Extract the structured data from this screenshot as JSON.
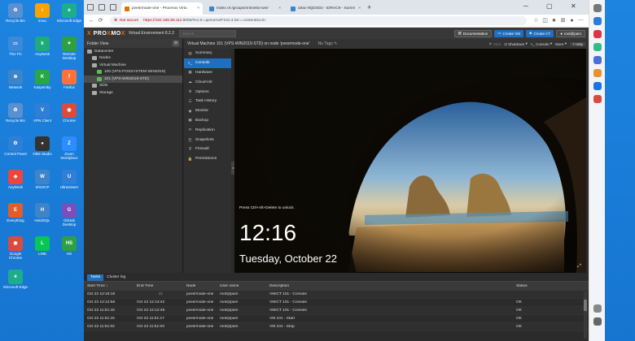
{
  "desktop": {
    "icons": [
      {
        "label": "Recycle Bin",
        "color": "#5a8fd0",
        "glyph": "♻"
      },
      {
        "label": "imou",
        "color": "#f6a400",
        "glyph": "i"
      },
      {
        "label": "Microsoft Edge",
        "color": "#1cae8a",
        "glyph": "e"
      },
      {
        "label": "This PC",
        "color": "#3d89d9",
        "glyph": "▭"
      },
      {
        "label": "AnyDesk",
        "color": "#1faa7b",
        "glyph": "k"
      },
      {
        "label": "Remote Desktop",
        "color": "#2ea043",
        "glyph": "✦"
      },
      {
        "label": "Network",
        "color": "#3e84c9",
        "glyph": "⊕"
      },
      {
        "label": "Kaspersky",
        "color": "#28a745",
        "glyph": "K"
      },
      {
        "label": "Firefox",
        "color": "#ff7139",
        "glyph": "f"
      },
      {
        "label": "Recycle Bin",
        "color": "#5a8fd0",
        "glyph": "♻"
      },
      {
        "label": "VPN Client",
        "color": "#2f7fd6",
        "glyph": "V"
      },
      {
        "label": "Chrome",
        "color": "#d94c3d",
        "glyph": "◉"
      },
      {
        "label": "Control Panel",
        "color": "#2f7fd6",
        "glyph": "⚙"
      },
      {
        "label": "OBS Studio",
        "color": "#333",
        "glyph": "●"
      },
      {
        "label": "Zoom Workplace",
        "color": "#2d8cff",
        "glyph": "Z"
      },
      {
        "label": "AnyDesk",
        "color": "#ef443b",
        "glyph": "◆"
      },
      {
        "label": "WinSCP",
        "color": "#3e84c9",
        "glyph": "W"
      },
      {
        "label": "Ultraviewer",
        "color": "#2f7fd6",
        "glyph": "U"
      },
      {
        "label": "Everything",
        "color": "#e55c2b",
        "glyph": "E"
      },
      {
        "label": "HeidiSQL",
        "color": "#3e84c9",
        "glyph": "H"
      },
      {
        "label": "GitHub Desktop",
        "color": "#7c4dbd",
        "glyph": "G"
      },
      {
        "label": "Google Chrome",
        "color": "#d94c3d",
        "glyph": "◉"
      },
      {
        "label": "LINE",
        "color": "#06c755",
        "glyph": "L"
      },
      {
        "label": "HS",
        "color": "#2ea043",
        "glyph": "HS"
      },
      {
        "label": "Microsoft Edge",
        "color": "#1cae8a",
        "glyph": "e"
      }
    ]
  },
  "browser": {
    "tabs": [
      {
        "title": "pvesrmode-one - Proxmox Virtu",
        "active": true,
        "color": "#e57000"
      },
      {
        "title": "Index of /groups/vnt/virtio-win/",
        "active": false,
        "color": "#3e84c9"
      },
      {
        "title": "idrac-9QD4D2 - iDRAC9 - Summ",
        "active": false,
        "color": "#3e84c9"
      }
    ],
    "new_tab": "+",
    "not_secure": "Not secure",
    "url_host": "https://192.168.98.111",
    "url_rest": ":8006/#v1:0:=qemu%2F101:4:25:=:contentIso:8::"
  },
  "pve": {
    "logo_a": "PRO",
    "logo_x": "X",
    "logo_b": "MO",
    "logo_x2": "X",
    "version": "Virtual Environment 8.2.2",
    "search_placeholder": "Search",
    "documentation": "Documentation",
    "create_vm": "Create VM",
    "create_ct": "Create CT",
    "user": "root@pam",
    "folder_view": "Folder View",
    "tree": [
      {
        "label": "Datacenter",
        "indent": 0,
        "color": "#9aa"
      },
      {
        "label": "Nodes",
        "indent": 1,
        "color": "#aaa"
      },
      {
        "label": "Virtual Machine",
        "indent": 1,
        "color": "#aaa"
      },
      {
        "label": "100 (VPS-POSSYSTEM-WIN2019)",
        "indent": 2,
        "color": "#5cb85c"
      },
      {
        "label": "101 (VPS-WIN2019-STD)",
        "indent": 2,
        "color": "#5cb85c",
        "selected": true
      },
      {
        "label": "SDN",
        "indent": 1,
        "color": "#aaa"
      },
      {
        "label": "Storage",
        "indent": 1,
        "color": "#aaa"
      }
    ],
    "vm_title": "Virtual Machine 101 (VPS-WIN2019-STD) on node 'pvesrmode-one'",
    "no_tags": "No Tags",
    "actions": {
      "start": "Start",
      "shutdown": "Shutdown",
      "console": "Console",
      "more": "More",
      "help": "Help"
    },
    "submenu": [
      {
        "label": "Summary",
        "icon": "▤"
      },
      {
        "label": "Console",
        "icon": ">_",
        "active": true
      },
      {
        "label": "Hardware",
        "icon": "▦"
      },
      {
        "label": "Cloud-Init",
        "icon": "☁"
      },
      {
        "label": "Options",
        "icon": "⚙"
      },
      {
        "label": "Task History",
        "icon": "☰"
      },
      {
        "label": "Monitor",
        "icon": "◉"
      },
      {
        "label": "Backup",
        "icon": "▣"
      },
      {
        "label": "Replication",
        "icon": "⟳"
      },
      {
        "label": "Snapshots",
        "icon": "⎘"
      },
      {
        "label": "Firewall",
        "icon": "⛨"
      },
      {
        "label": "Permissions",
        "icon": "🔒"
      }
    ],
    "console": {
      "lock_msg": "Press Ctrl+Alt+Delete to unlock.",
      "time": "12:16",
      "date": "Tuesday, October 22"
    },
    "bottom_tabs": [
      "Tasks",
      "Cluster log"
    ],
    "columns": [
      "Start Time ↓",
      "End Time",
      "Node",
      "User name",
      "Description",
      "Status"
    ],
    "tasks": [
      [
        "Oct 22 12:16:18",
        "",
        "pvesrmode-one",
        "root@pam",
        "VM/CT 101 - Console",
        ""
      ],
      [
        "Oct 22 12:12:58",
        "Oct 22 12:13:42",
        "pvesrmode-one",
        "root@pam",
        "VM/CT 101 - Console",
        "OK"
      ],
      [
        "Oct 22 11:51:18",
        "Oct 22 12:12:49",
        "pvesrmode-one",
        "root@pam",
        "VM/CT 101 - Console",
        "OK"
      ],
      [
        "Oct 22 11:51:15",
        "Oct 22 11:51:17",
        "pvesrmode-one",
        "root@pam",
        "VM 101 - Start",
        "OK"
      ],
      [
        "Oct 22 11:51:02",
        "Oct 22 11:51:03",
        "pvesrmode-one",
        "root@pam",
        "VM 101 - Stop",
        "OK"
      ]
    ]
  },
  "right_sidebar": {
    "icons": [
      "search-icon",
      "copilot-icon",
      "tag-icon",
      "person-icon",
      "shopping-icon",
      "games-icon",
      "outlook-icon",
      "office-icon",
      "add-icon",
      "settings-icon"
    ]
  }
}
